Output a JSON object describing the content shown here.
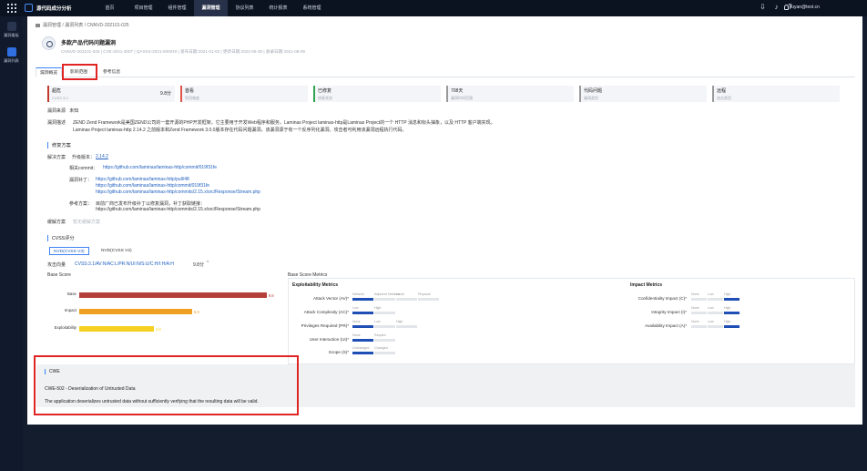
{
  "header": {
    "app_title": "源代码成分分析",
    "nav": [
      "首页",
      "项目管理",
      "组件管理",
      "漏洞管理",
      "协议列表",
      "统计报表",
      "系统管理"
    ],
    "active_nav": "漏洞管理",
    "user": "liuyan@test.cn"
  },
  "sidebar": {
    "items": [
      {
        "label": "漏洞看板",
        "icon": "dashboard-icon"
      },
      {
        "label": "漏洞列表",
        "icon": "document-icon"
      }
    ]
  },
  "breadcrumb": {
    "items": [
      "漏洞管理",
      "漏洞列表",
      "CNNVD-202101-025"
    ]
  },
  "vuln": {
    "title": "多款产品代码问题漏洞",
    "ids": "CNNVD-202101-025 | CVE-2021-3007 | QAXSS-2021-000040 | 发布日期:2021-01-02 | 更新日期:2022-05-30 | 收录日期:2021-08-09"
  },
  "tabs": [
    "漏洞概览",
    "影响范围",
    "参考信息"
  ],
  "active_tab": "漏洞概览",
  "summary": [
    {
      "value": "超危",
      "sub": "CVSS 3.0",
      "score": "9.8分",
      "color": "#c0392b"
    },
    {
      "value": "首看",
      "sub": "利用难度",
      "score": "",
      "color": "#e0524a"
    },
    {
      "value": "已修复",
      "sub": "修复状态",
      "score": "",
      "color": "#2ea44f"
    },
    {
      "value": "708天",
      "sub": "漏洞时间范围",
      "score": "",
      "color": "#888888"
    },
    {
      "value": "代码问题",
      "sub": "漏洞类型",
      "score": "",
      "color": "#888888"
    },
    {
      "value": "远程",
      "sub": "攻击类型",
      "score": "",
      "color": "#888888"
    }
  ],
  "overview": {
    "source_label": "漏洞来源",
    "source_value": "未知",
    "desc_label": "漏洞描述",
    "desc_line1": "ZEND Zend Framework是美国ZEND公司的一套开源的PHP开发框架。它主要用于开发Web程序和服务。Laminas Project laminas-http是Laminas Project的一个 HTTP 消息和标头抽象，以及 HTTP 客户端实现。",
    "desc_line2": "Laminas Project laminas-http 2.14.2 之前版本和Zend Framework 3.0.0版本存在代码问题漏洞，该漏洞源于有一个反序列化漏洞。攻击者可利用该漏洞远程执行代码。"
  },
  "fix": {
    "section_title": "修复方案",
    "solution_label": "解决方案",
    "upgrade_label": "升级版本：",
    "upgrade_version": "2.14.2",
    "commit_label": "相关commit：",
    "commit_link": "https://github.com/laminas/laminas-http/commit/019f31fe",
    "patch_label": "漏洞补丁：",
    "patch_links": [
      "https://github.com/laminas/laminas-http/pull/48",
      "https://github.com/laminas/laminas-http/commit/019f31fe",
      "https://github.com/laminas/laminas-http/commits/2.15.x/src/Response/Stream.php"
    ],
    "ref_label": "参考方案：",
    "ref_text": "目前厂商已发布升级补丁以修复漏洞，补丁获取链接：",
    "ref_link": "https://github.com/laminas/laminas-http/commits/2.15.x/src/Response/Stream.php",
    "mitigation_label": "缓解方案",
    "mitigation_value": "暂无缓解方案"
  },
  "cvss": {
    "section_title": "CVSS评分",
    "tabs": [
      "NVD(CVSS V3)",
      "NVD(CVSS V2)"
    ],
    "vector_label": "攻击向量",
    "vector": "CVSS:3.1/AV:N/AC:L/PR:N/UI:N/S:U/C:H/I:H/A:H",
    "score": "9.8分",
    "base_score_title": "Base Score",
    "metrics_title": "Base Score Metrics",
    "exploitability_title": "Exploitability Metrics",
    "impact_title": "Impact Metrics"
  },
  "chart_data": {
    "type": "bar",
    "title": "Base Score",
    "categories": [
      "Base",
      "Impact",
      "Exploitability"
    ],
    "values": [
      9.8,
      5.9,
      3.9
    ],
    "colors": [
      "#b5403a",
      "#f0a020",
      "#f5d020"
    ],
    "xlim": [
      0,
      10
    ]
  },
  "exploitability_metrics": [
    {
      "name": "Attack Vector (AV)*",
      "options": [
        "Network",
        "Adjacent Network",
        "Local",
        "Physical"
      ],
      "selected": 0
    },
    {
      "name": "Attack Complexity (AC)*",
      "options": [
        "Low",
        "High"
      ],
      "selected": 0
    },
    {
      "name": "Privileges Required (PR)*",
      "options": [
        "None",
        "Low",
        "High"
      ],
      "selected": 0
    },
    {
      "name": "User Interaction (UI)*",
      "options": [
        "None",
        "Require"
      ],
      "selected": 0
    },
    {
      "name": "Scope (S)*",
      "options": [
        "Unchanged",
        "Changed"
      ],
      "selected": 0
    }
  ],
  "impact_metrics": [
    {
      "name": "Confidentiality Impact (C)*",
      "options": [
        "None",
        "Low",
        "High"
      ],
      "selected": 2
    },
    {
      "name": "Integrity Impact (I)*",
      "options": [
        "None",
        "Low",
        "High"
      ],
      "selected": 2
    },
    {
      "name": "Availability Impact (A)*",
      "options": [
        "None",
        "Low",
        "High"
      ],
      "selected": 2
    }
  ],
  "cwe": {
    "tag": "CWE",
    "name": "CWE-502 - Deserialization of Untrusted Data",
    "desc": "The application deserializes untrusted data without sufficiently verifying that the resulting data will be valid."
  }
}
